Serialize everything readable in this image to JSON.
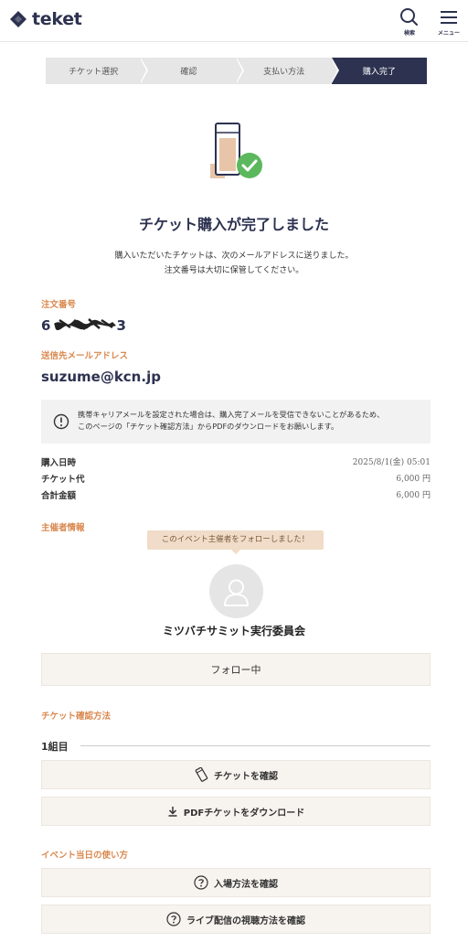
{
  "header": {
    "logo_text": "teket",
    "search_label": "検索",
    "menu_label": "メニュー"
  },
  "steps": [
    "チケット選択",
    "確認",
    "支払い方法",
    "購入完了"
  ],
  "complete": {
    "title": "チケット購入が完了しました",
    "desc_line1": "購入いただいたチケットは、次のメールアドレスに送りました。",
    "desc_line2": "注文番号は大切に保管してください。"
  },
  "order": {
    "label": "注文番号",
    "number_prefix": "6",
    "number_suffix": "3"
  },
  "email": {
    "label": "送信先メールアドレス",
    "value": "suzume@kcn.jp"
  },
  "notice": {
    "line1": "携帯キャリアメールを設定された場合は、購入完了メールを受信できないことがあるため、",
    "line2": "このページの「チケット確認方法」からPDFのダウンロードをお願いします。"
  },
  "summary": [
    {
      "key": "購入日時",
      "value": "2025/8/1(金) 05:01"
    },
    {
      "key": "チケット代",
      "value": "6,000 円"
    },
    {
      "key": "合計金額",
      "value": "6,000 円"
    }
  ],
  "organizer": {
    "label": "主催者情報",
    "tooltip": "このイベント主催者をフォローしました！",
    "name": "ミツバチサミット実行委員会",
    "follow_button": "フォロー中"
  },
  "ticket_check": {
    "label": "チケット確認方法",
    "group": "1組目",
    "view_button": "チケットを確認",
    "pdf_button": "PDFチケットをダウンロード"
  },
  "event_day": {
    "label": "イベント当日の使い方",
    "entry_button": "入場方法を確認",
    "live_button": "ライブ配信の視聴方法を確認"
  },
  "colors": {
    "navy": "#2d3250",
    "accent_orange": "#d9884f",
    "check_green": "#5cb85c"
  }
}
